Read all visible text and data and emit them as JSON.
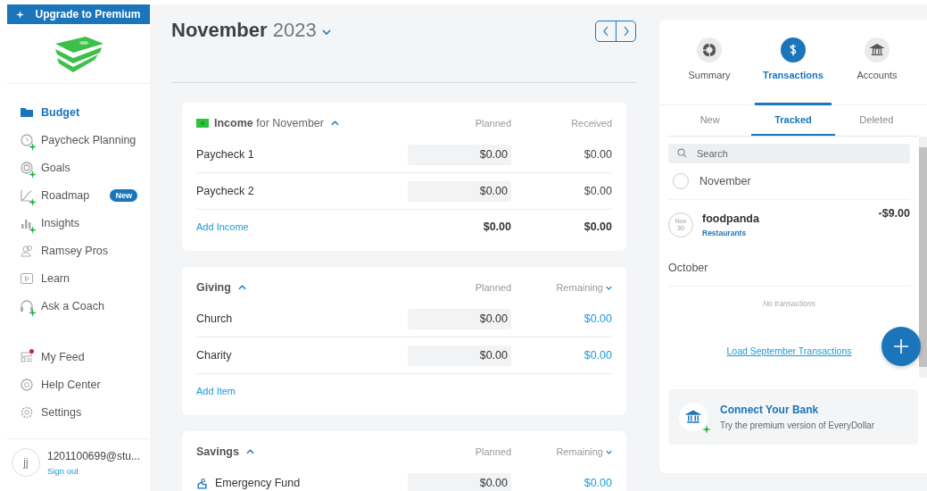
{
  "sidebar": {
    "upgrade_button": "Upgrade to Premium",
    "nav": [
      {
        "label": "Budget",
        "selected": true,
        "premium": false
      },
      {
        "label": "Paycheck Planning",
        "selected": false,
        "premium": true
      },
      {
        "label": "Goals",
        "selected": false,
        "premium": true
      },
      {
        "label": "Roadmap",
        "selected": false,
        "premium": true,
        "badge": "New"
      },
      {
        "label": "Insights",
        "selected": false,
        "premium": true
      },
      {
        "label": "Ramsey Pros",
        "selected": false,
        "premium": false
      },
      {
        "label": "Learn",
        "selected": false,
        "premium": false
      },
      {
        "label": "Ask a Coach",
        "selected": false,
        "premium": true
      }
    ],
    "secondary": [
      {
        "label": "My Feed",
        "notification": true
      },
      {
        "label": "Help Center",
        "notification": false
      },
      {
        "label": "Settings",
        "notification": false
      }
    ],
    "user": {
      "initials": "jj",
      "email": "1201100699@stu...",
      "sign_out": "Sign out"
    }
  },
  "header": {
    "month": "November",
    "year": "2023"
  },
  "sections": [
    {
      "kind": "income",
      "title": "Income",
      "subtitle": "for November",
      "columns": [
        "Planned",
        "Received"
      ],
      "rows": [
        {
          "name": "Paycheck 1",
          "planned": "$0.00",
          "value": "$0.00"
        },
        {
          "name": "Paycheck 2",
          "planned": "$0.00",
          "value": "$0.00"
        }
      ],
      "add_label": "Add Income",
      "totals": [
        "$0.00",
        "$0.00"
      ]
    },
    {
      "kind": "expense",
      "title": "Giving",
      "columns": [
        "Planned",
        "Remaining"
      ],
      "rows": [
        {
          "name": "Church",
          "planned": "$0.00",
          "value": "$0.00"
        },
        {
          "name": "Charity",
          "planned": "$0.00",
          "value": "$0.00"
        }
      ],
      "add_label": "Add Item"
    },
    {
      "kind": "expense",
      "title": "Savings",
      "columns": [
        "Planned",
        "Remaining"
      ],
      "rows": [
        {
          "name": "Emergency Fund",
          "planned": "$0.00",
          "value": "$0.00",
          "fund": true
        }
      ]
    }
  ],
  "panel": {
    "tabs": [
      {
        "label": "Summary",
        "selected": false
      },
      {
        "label": "Transactions",
        "selected": true
      },
      {
        "label": "Accounts",
        "selected": false
      }
    ],
    "subtabs": [
      {
        "label": "New",
        "selected": false
      },
      {
        "label": "Tracked",
        "selected": true
      },
      {
        "label": "Deleted",
        "selected": false
      }
    ],
    "search": {
      "placeholder": "Search"
    },
    "groups": [
      {
        "month": "November",
        "select_all": {
          "checked": false
        },
        "transactions": [
          {
            "merchant": "foodpanda",
            "category": "Restaurants",
            "amount": "-$9.00",
            "date_month": "Nov",
            "date_day": "30"
          }
        ]
      },
      {
        "month": "October",
        "empty_text": "No transactions"
      }
    ],
    "load_link": "Load September Transactions",
    "connect_bank": {
      "title": "Connect Your Bank",
      "subtitle": "Try the premium version of EveryDollar"
    }
  }
}
